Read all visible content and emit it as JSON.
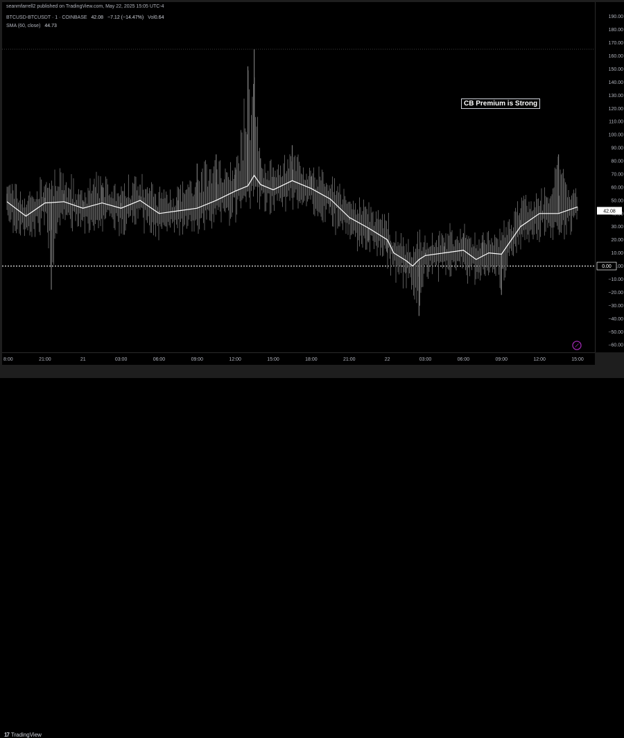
{
  "publisher_line": "seanmfarrell2 published on TradingView.com, May 22, 2025 15:05 UTC-4",
  "legend": {
    "symbol": "BTCUSD-BTCUSDT · 1 · COINBASE",
    "last": "42.08",
    "change": "−7.12 (−14.47%)",
    "vol_label": "Vol",
    "vol_value": "0.64",
    "sma_label": "SMA (60, close)",
    "sma_value": "44.73"
  },
  "annotation": "CB Premium is Strong",
  "current_price_tag": "42.08",
  "zero_tag": "0.00",
  "brand": "TradingView",
  "colors": {
    "background": "#000000",
    "bars": "#5d5d5d",
    "sma_line": "#ffffff",
    "zero_line": "#ffffff",
    "price_tag_bg": "#ffffff"
  },
  "chart_data": {
    "type": "line",
    "series": [
      {
        "name": "SMA (60, close)",
        "x": [
          "18:00",
          "19:30",
          "21:00",
          "22:30",
          "00:00",
          "01:30",
          "03:00",
          "04:30",
          "06:00",
          "07:30",
          "09:00",
          "10:30",
          "12:00",
          "13:00",
          "13:30",
          "14:00",
          "15:00",
          "16:30",
          "18:00",
          "19:30",
          "21:00",
          "22:30",
          "00:00",
          "00:30",
          "01:30",
          "02:00",
          "02:30",
          "03:00",
          "04:30",
          "06:00",
          "07:00",
          "08:00",
          "09:00",
          "10:30",
          "12:00",
          "13:30",
          "15:00"
        ],
        "values": [
          49,
          38,
          48,
          49,
          44,
          48,
          44,
          50,
          40,
          42,
          44,
          50,
          57,
          61,
          69,
          62,
          58,
          65,
          59,
          51,
          37,
          29,
          20,
          10,
          4,
          0,
          5,
          8,
          10,
          12,
          5,
          10,
          9,
          30,
          40,
          40,
          45
        ]
      },
      {
        "name": "BTCUSD-BTCUSDT",
        "x": [
          "18:00",
          "19:30",
          "21:00",
          "21:30",
          "22:30",
          "00:00",
          "01:30",
          "03:00",
          "04:30",
          "06:00",
          "07:30",
          "09:00",
          "10:30",
          "12:00",
          "13:00",
          "13:30",
          "14:00",
          "15:00",
          "16:30",
          "18:00",
          "19:30",
          "21:00",
          "22:30",
          "00:00",
          "01:30",
          "02:30",
          "03:00",
          "04:30",
          "06:00",
          "07:30",
          "09:00",
          "10:30",
          "12:00",
          "13:30",
          "15:00"
        ],
        "values": [
          55,
          40,
          52,
          -18,
          55,
          50,
          60,
          48,
          62,
          42,
          50,
          78,
          85,
          75,
          152,
          165,
          82,
          75,
          92,
          68,
          45,
          35,
          18,
          10,
          -5,
          -38,
          10,
          15,
          25,
          18,
          -22,
          35,
          40,
          85,
          42
        ]
      }
    ],
    "x_tick_labels": [
      "8:00",
      "21:00",
      "21",
      "03:00",
      "06:00",
      "09:00",
      "12:00",
      "15:00",
      "18:00",
      "21:00",
      "22",
      "03:00",
      "06:00",
      "09:00",
      "12:00",
      "15:00"
    ],
    "y_ticks": [
      -60,
      -50,
      -40,
      -30,
      -20,
      -10,
      0,
      10,
      20,
      30,
      40,
      50,
      60,
      70,
      80,
      90,
      100,
      110,
      120,
      130,
      140,
      150,
      160,
      170,
      180,
      190
    ],
    "y_tick_labels": [
      "−60.00",
      "−50.00",
      "−40.00",
      "−30.00",
      "−20.00",
      "−10.00",
      "0.00",
      "10.00",
      "20.00",
      "30.00",
      "40.00",
      "50.00",
      "60.00",
      "70.00",
      "80.00",
      "90.00",
      "100.00",
      "110.00",
      "120.00",
      "130.00",
      "140.00",
      "150.00",
      "160.00",
      "170.00",
      "180.00",
      "190.00"
    ],
    "ylim": [
      -62,
      193
    ],
    "grid": false,
    "horizontal_lines": [
      0,
      165
    ]
  }
}
